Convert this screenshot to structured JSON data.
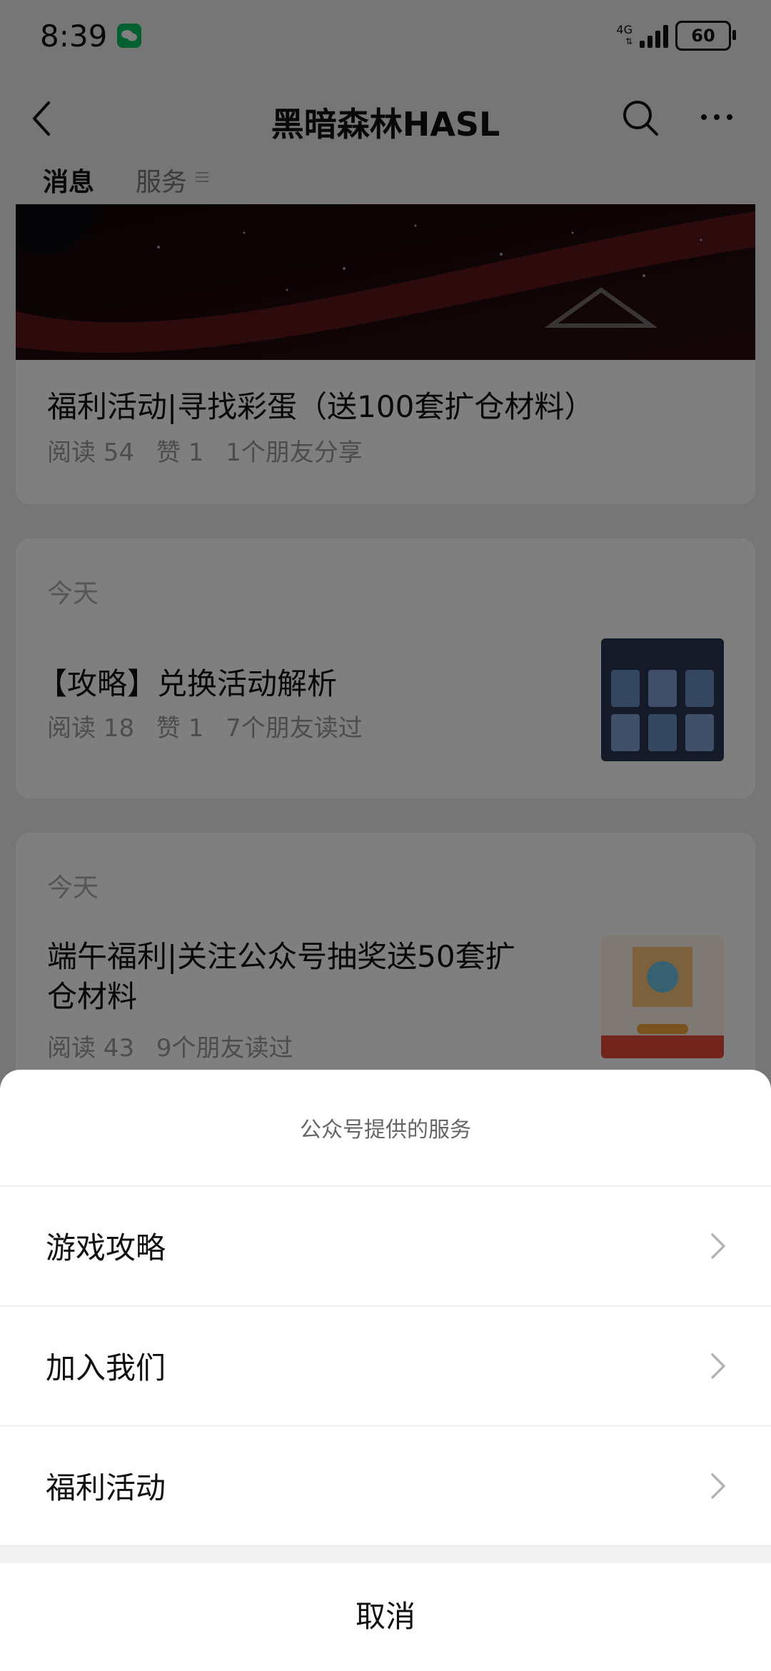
{
  "status_bar": {
    "time": "8:39",
    "network": "4G",
    "battery": "60"
  },
  "navbar": {
    "title": "黑暗森林HASL",
    "back_icon": "back-icon",
    "search_icon": "search-icon",
    "more_icon": "more-icon"
  },
  "tabs": [
    {
      "label": "消息",
      "active": true
    },
    {
      "label": "服务",
      "active": false
    }
  ],
  "articles": [
    {
      "title": "福利活动|寻找彩蛋（送100套扩仓材料）",
      "stats": [
        "阅读 54",
        "赞 1",
        "1个朋友分享"
      ]
    },
    {
      "date": "今天",
      "title": "【攻略】兑换活动解析",
      "stats": [
        "阅读 18",
        "赞 1",
        "7个朋友读过"
      ]
    },
    {
      "date": "今天",
      "title_line1": "端午福利|关注公众号抽奖送50套扩",
      "title_line2": "仓材料",
      "stats": [
        "阅读 43",
        "9个朋友读过"
      ]
    }
  ],
  "sheet": {
    "header": "公众号提供的服务",
    "items": [
      {
        "label": "游戏攻略"
      },
      {
        "label": "加入我们"
      },
      {
        "label": "福利活动"
      }
    ],
    "cancel": "取消"
  },
  "colors": {
    "wechat_green": "#07c160",
    "overlay": "rgba(0,0,0,0.5)"
  }
}
